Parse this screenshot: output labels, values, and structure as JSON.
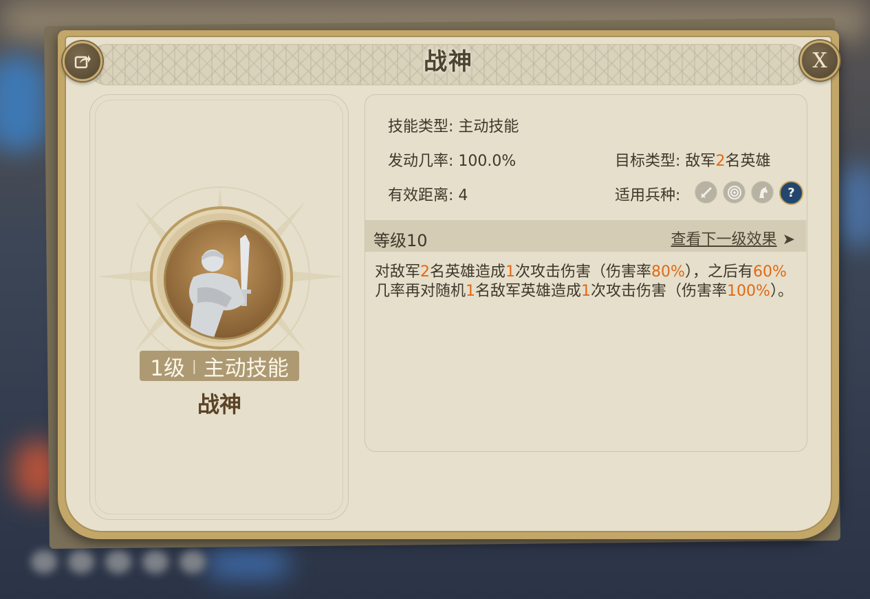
{
  "dialog": {
    "title": "战神",
    "close_label": "X"
  },
  "skill": {
    "level_text": "1级",
    "type_text": "主动技能",
    "name": "战神"
  },
  "info": {
    "skill_type_label": "技能类型:",
    "skill_type_value": "主动技能",
    "trigger_rate_label": "发动几率:",
    "trigger_rate_value": "100.0%",
    "range_label": "有效距离:",
    "range_value": "4",
    "target_type_label": "目标类型:",
    "target_type_prefix": "敌军",
    "target_type_count": "2",
    "target_type_suffix": "名英雄",
    "troop_type_label": "适用兵种:",
    "troop_icons": [
      "sword-icon",
      "bow-target-icon",
      "horse-icon",
      "question-icon"
    ],
    "question_glyph": "?"
  },
  "level_bar": {
    "label": "等级10",
    "next_link": "查看下一级效果",
    "arrow": "➤"
  },
  "description": {
    "segments": [
      {
        "t": "对敌军"
      },
      {
        "t": "2",
        "hl": true
      },
      {
        "t": "名英雄造成"
      },
      {
        "t": "1",
        "hl": true
      },
      {
        "t": "次攻击伤害（伤害率"
      },
      {
        "t": "80%",
        "hl": true
      },
      {
        "t": "），之后有"
      },
      {
        "t": "60%",
        "hl": true
      },
      {
        "t": "几率再对随机"
      },
      {
        "t": "1",
        "hl": true
      },
      {
        "t": "名敌军英雄造成"
      },
      {
        "t": "1",
        "hl": true
      },
      {
        "t": "次攻击伤害（伤害率"
      },
      {
        "t": "100%",
        "hl": true
      },
      {
        "t": "）。"
      }
    ]
  },
  "colors": {
    "highlight": "#e16914",
    "panel_bg": "#e7e0cc",
    "frame_gold": "#c3a769",
    "text_dark": "#3f372b"
  }
}
